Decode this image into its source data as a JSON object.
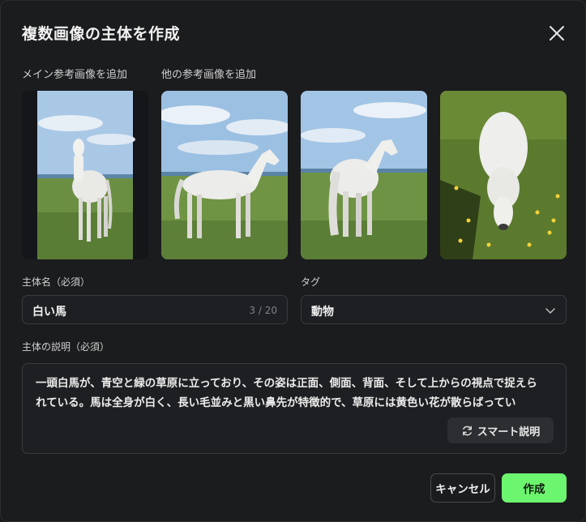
{
  "dialog": {
    "title": "複数画像の主体を作成"
  },
  "images": {
    "main_label": "メイン参考画像を追加",
    "other_label": "他の参考画像を追加"
  },
  "form": {
    "name_label": "主体名（必須）",
    "name_value": "白い馬",
    "name_counter": "3 / 20",
    "tag_label": "タグ",
    "tag_value": "動物",
    "desc_label": "主体の説明（必須）",
    "desc_value": "一頭白馬が、青空と緑の草原に立っており、その姿は正面、側面、背面、そして上からの視点で捉えられている。馬は全身が白く、長い毛並みと黒い鼻先が特徴的で、草原には黄色い花が散らばってい",
    "smart_label": "スマート説明"
  },
  "footer": {
    "cancel_label": "キャンセル",
    "create_label": "作成"
  },
  "colors": {
    "background": "#1b1c1e",
    "accent": "#6cf56e"
  }
}
